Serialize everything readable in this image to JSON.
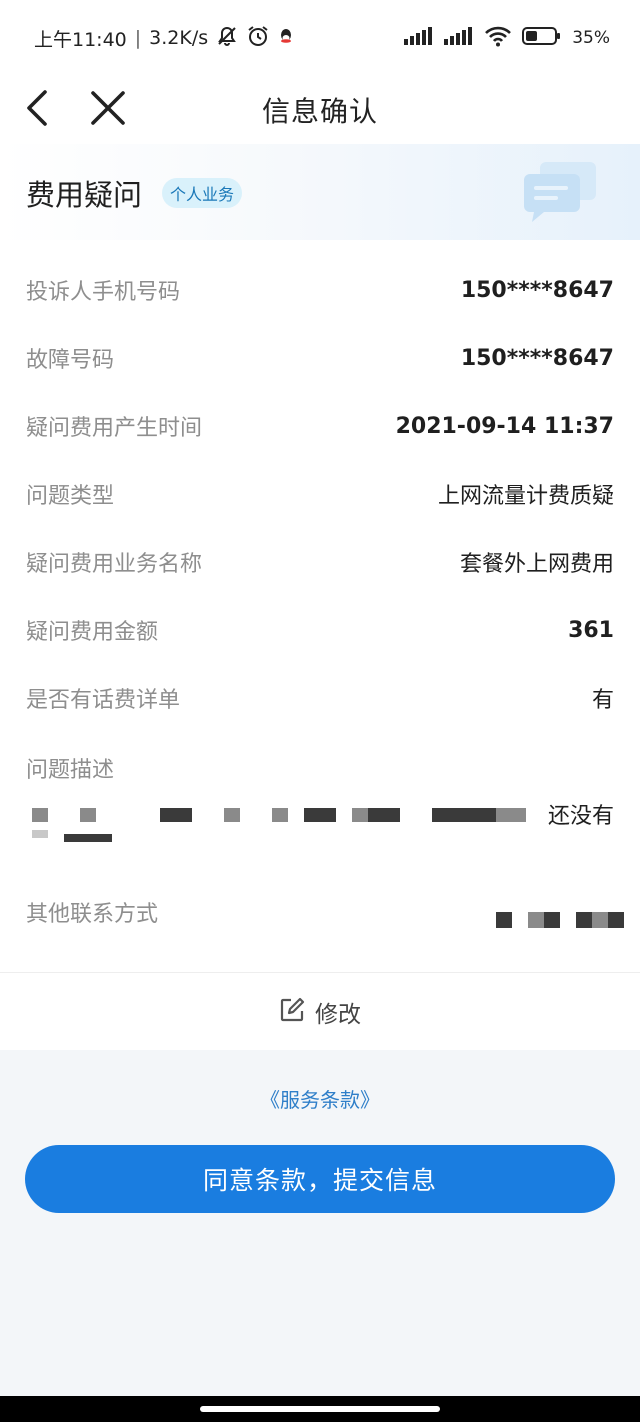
{
  "status": {
    "time": "上午11:40",
    "speed": "3.2K/s",
    "battery": "35%",
    "icons": [
      "bell-off-icon",
      "alarm-icon",
      "qq-icon",
      "signal-icon",
      "signal-icon",
      "wifi-icon",
      "battery-icon"
    ]
  },
  "nav": {
    "title": "信息确认",
    "back_icon": "chevron-left-icon",
    "close_icon": "close-icon"
  },
  "banner": {
    "title": "费用疑问",
    "tag": "个人业务",
    "icon": "chat-bubbles-icon"
  },
  "fields": [
    {
      "label": "投诉人手机号码",
      "value": "150****8647"
    },
    {
      "label": "故障号码",
      "value": "150****8647"
    },
    {
      "label": "疑问费用产生时间",
      "value": "2021-09-14 11:37"
    },
    {
      "label": "问题类型",
      "value": "上网流量计费质疑"
    },
    {
      "label": "疑问费用业务名称",
      "value": "套餐外上网费用"
    },
    {
      "label": "疑问费用金额",
      "value": "361"
    },
    {
      "label": "是否有话费详单",
      "value": "有"
    }
  ],
  "description": {
    "label": "问题描述",
    "visible_text": "还没有"
  },
  "contact": {
    "label": "其他联系方式"
  },
  "edit": {
    "label": "修改",
    "icon": "edit-icon"
  },
  "terms": {
    "link": "《服务条款》"
  },
  "submit": {
    "label": "同意条款，提交信息"
  },
  "colors": {
    "primary": "#1a7de0",
    "link": "#2f7fc9",
    "tag_bg": "#d9f1fb",
    "tag_text": "#1a78b8",
    "page_bg": "#f3f6f9"
  }
}
